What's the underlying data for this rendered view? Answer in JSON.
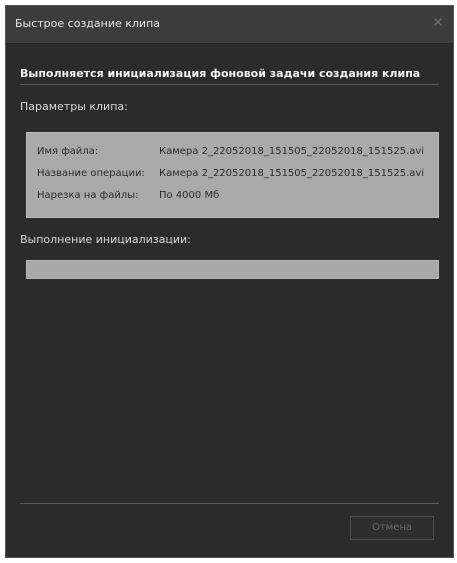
{
  "window": {
    "title": "Быстрое создание клипа",
    "close_icon": "close-icon"
  },
  "content": {
    "heading": "Выполняется инициализация фоновой задачи создания клипа",
    "params_label": "Параметры клипа:",
    "params": [
      {
        "key": "Имя файла:",
        "value": "Камера 2_22052018_151505_22052018_151525.avi"
      },
      {
        "key": "Название операции:",
        "value": "Камера 2_22052018_151505_22052018_151525.avi"
      },
      {
        "key": "Нарезка на файлы:",
        "value": "По 4000 Мб"
      }
    ],
    "init_label": "Выполнение инициализации:",
    "progress_fraction": 0
  },
  "footer": {
    "cancel_label": "Отмена",
    "cancel_enabled": false
  },
  "colors": {
    "window_bg": "#2b2b2b",
    "titlebar_bg": "#3c3c3c",
    "panel_bg": "#aaaaaa",
    "progress_track": "#a9a9a9",
    "disabled_text": "#6a6a6a"
  }
}
